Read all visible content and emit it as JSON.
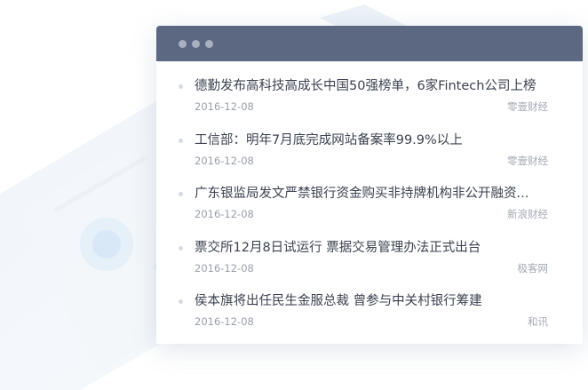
{
  "window": {
    "controls": [
      "close-dot",
      "minimize-dot",
      "maximize-dot"
    ]
  },
  "colors": {
    "titlebar": "#5c6882",
    "title_text": "#3c4250",
    "meta_text": "#9aa0ab"
  },
  "news": [
    {
      "title": "德勤发布高科技高成长中国50强榜单，6家Fintech公司上榜",
      "date": "2016-12-08",
      "source": "零壹财经"
    },
    {
      "title": "工信部：明年7月底完成网站备案率99.9%以上",
      "date": "2016-12-08",
      "source": "零壹财经"
    },
    {
      "title": "广东银监局发文严禁银行资金购买非持牌机构非公开融资...",
      "date": "2016-12-08",
      "source": "新浪财经"
    },
    {
      "title": "票交所12月8日试运行 票据交易管理办法正式出台",
      "date": "2016-12-08",
      "source": "极客网"
    },
    {
      "title": "侯本旗将出任民生金服总裁 曾参与中关村银行筹建",
      "date": "2016-12-08",
      "source": "和讯"
    }
  ]
}
